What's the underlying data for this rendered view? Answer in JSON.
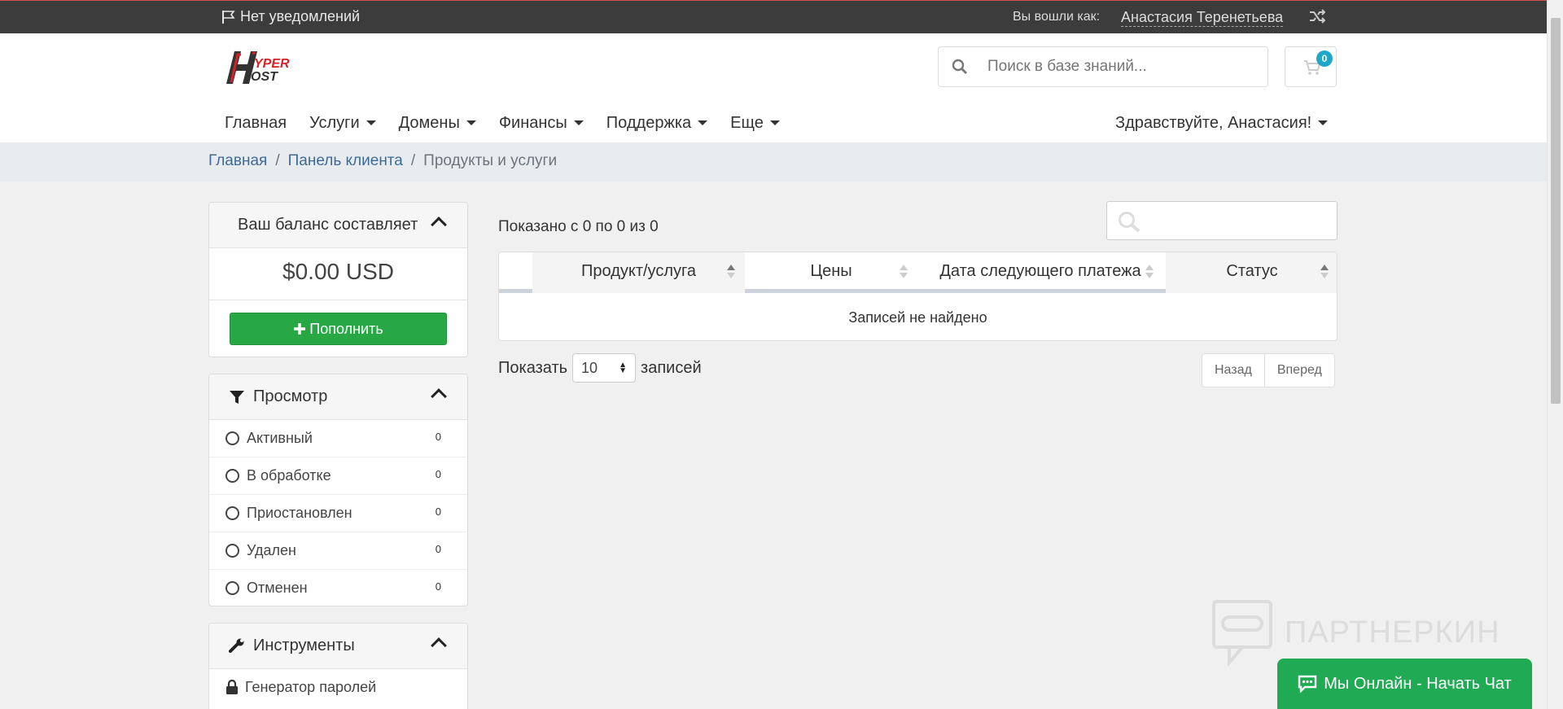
{
  "topbar": {
    "notifications": "Нет уведомлений",
    "logged_in_as": "Вы вошли как:",
    "user_name": "Анастасия Теренетьева"
  },
  "header": {
    "logo_text_top": "YPER",
    "logo_text_bottom": "OST",
    "search_placeholder": "Поиск в базе знаний...",
    "cart_count": "0"
  },
  "nav": {
    "items": [
      {
        "label": "Главная"
      },
      {
        "label": "Услуги"
      },
      {
        "label": "Домены"
      },
      {
        "label": "Финансы"
      },
      {
        "label": "Поддержка"
      },
      {
        "label": "Еще"
      }
    ],
    "greeting": "Здравствуйте, Анастасия!"
  },
  "breadcrumb": {
    "items": [
      "Главная",
      "Панель клиента",
      "Продукты и услуги"
    ]
  },
  "balance": {
    "title": "Ваш баланс составляет",
    "amount": "$0.00 USD",
    "topup_label": "Пополнить"
  },
  "filter": {
    "title": "Просмотр",
    "items": [
      {
        "label": "Активный",
        "count": "0"
      },
      {
        "label": "В обработке",
        "count": "0"
      },
      {
        "label": "Приостановлен",
        "count": "0"
      },
      {
        "label": "Удален",
        "count": "0"
      },
      {
        "label": "Отменен",
        "count": "0"
      }
    ]
  },
  "tools": {
    "title": "Инструменты",
    "items": [
      {
        "label": "Генератор паролей"
      }
    ]
  },
  "table": {
    "info": "Показано с 0 по 0 из 0",
    "columns": [
      "Продукт/услуга",
      "Цены",
      "Дата следующего платежа",
      "Статус"
    ],
    "empty": "Записей не найдено",
    "length_prefix": "Показать",
    "length_value": "10",
    "length_suffix": "записей",
    "prev": "Назад",
    "next": "Вперед"
  },
  "watermark": "ПАРТНЕРКИН",
  "chat_label": "Мы Онлайн - Начать Чат",
  "colors": {
    "topbar": "#3c3c3c",
    "primary_green": "#28a745",
    "chat_green": "#1faa53",
    "badge": "#1fa7c7",
    "link": "#3d6b9a"
  }
}
